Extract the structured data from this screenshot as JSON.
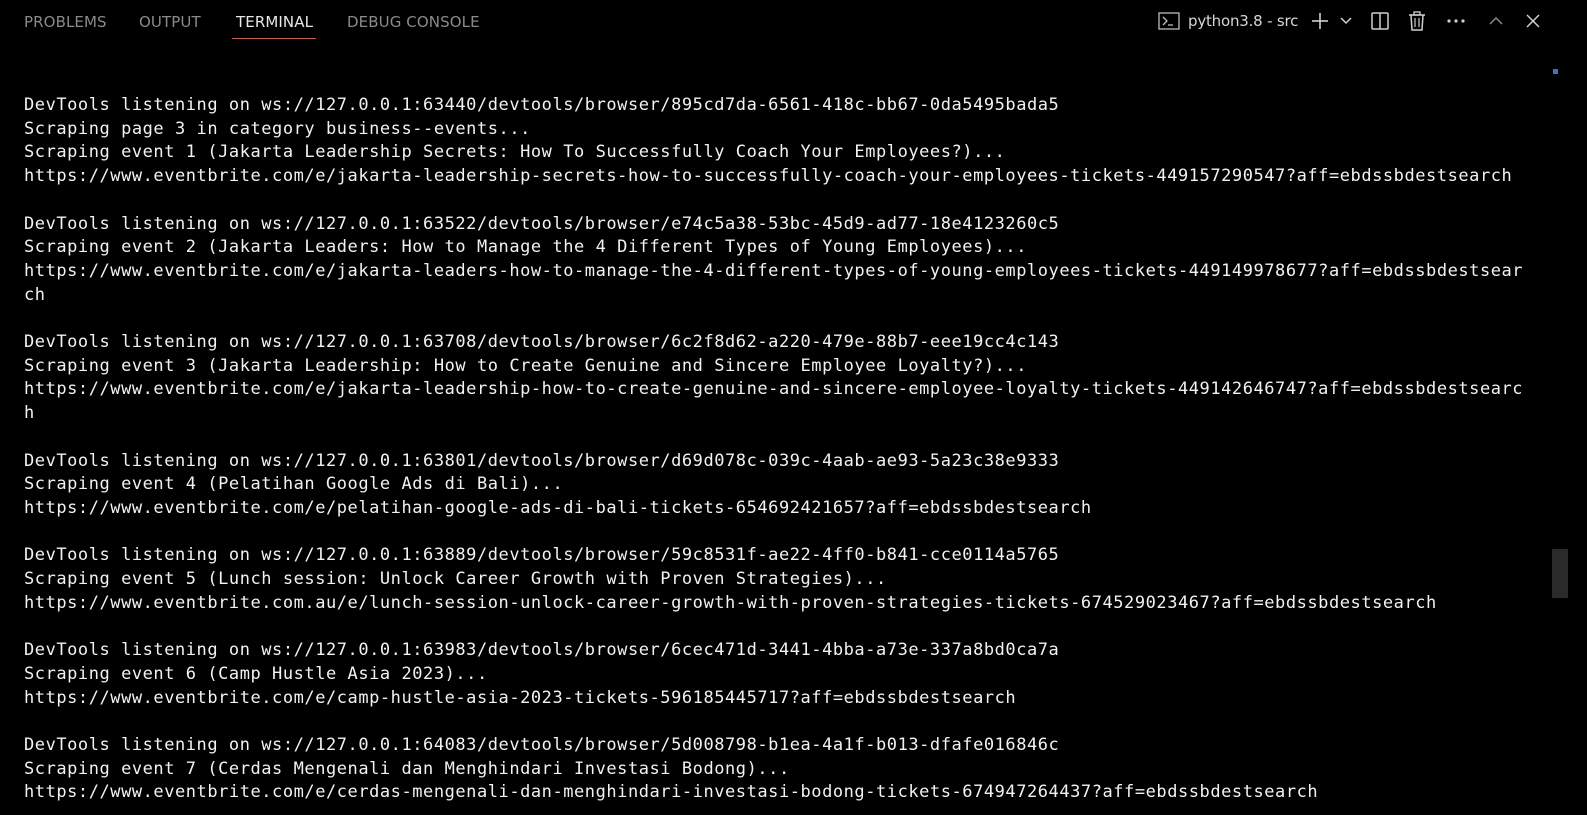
{
  "tabs": {
    "problems": "PROBLEMS",
    "output": "OUTPUT",
    "terminal": "TERMINAL",
    "debug_console": "DEBUG CONSOLE"
  },
  "active_tab": "TERMINAL",
  "terminal_instance": {
    "label": "python3.8 - src"
  },
  "toolbar_icons": [
    "terminal-icon",
    "plus-icon",
    "chevron-down-icon",
    "split-icon",
    "trash-icon",
    "more-icon",
    "chevron-up-icon",
    "close-icon"
  ],
  "colors": {
    "background": "#000000",
    "text": "#f2f2f2",
    "active_tab_underline": "#c75c4a",
    "scroll_marker": "#3a75c4"
  },
  "terminal_lines": [
    "DevTools listening on ws://127.0.0.1:63440/devtools/browser/895cd7da-6561-418c-bb67-0da5495bada5",
    "Scraping page 3 in category business--events...",
    "Scraping event 1 (Jakarta Leadership Secrets: How To Successfully Coach Your Employees?)...",
    "https://www.eventbrite.com/e/jakarta-leadership-secrets-how-to-successfully-coach-your-employees-tickets-449157290547?aff=ebdssbdestsearch",
    "",
    "DevTools listening on ws://127.0.0.1:63522/devtools/browser/e74c5a38-53bc-45d9-ad77-18e4123260c5",
    "Scraping event 2 (Jakarta Leaders: How to Manage the 4 Different Types of Young Employees)...",
    "https://www.eventbrite.com/e/jakarta-leaders-how-to-manage-the-4-different-types-of-young-employees-tickets-449149978677?aff=ebdssbdestsear",
    "ch",
    "",
    "DevTools listening on ws://127.0.0.1:63708/devtools/browser/6c2f8d62-a220-479e-88b7-eee19cc4c143",
    "Scraping event 3 (Jakarta Leadership: How to Create Genuine and Sincere Employee Loyalty?)...",
    "https://www.eventbrite.com/e/jakarta-leadership-how-to-create-genuine-and-sincere-employee-loyalty-tickets-449142646747?aff=ebdssbdestsearc",
    "h",
    "",
    "DevTools listening on ws://127.0.0.1:63801/devtools/browser/d69d078c-039c-4aab-ae93-5a23c38e9333",
    "Scraping event 4 (Pelatihan Google Ads di Bali)...",
    "https://www.eventbrite.com/e/pelatihan-google-ads-di-bali-tickets-654692421657?aff=ebdssbdestsearch",
    "",
    "DevTools listening on ws://127.0.0.1:63889/devtools/browser/59c8531f-ae22-4ff0-b841-cce0114a5765",
    "Scraping event 5 (Lunch session: Unlock Career Growth with Proven Strategies)...",
    "https://www.eventbrite.com.au/e/lunch-session-unlock-career-growth-with-proven-strategies-tickets-674529023467?aff=ebdssbdestsearch",
    "",
    "DevTools listening on ws://127.0.0.1:63983/devtools/browser/6cec471d-3441-4bba-a73e-337a8bd0ca7a",
    "Scraping event 6 (Camp Hustle Asia 2023)...",
    "https://www.eventbrite.com/e/camp-hustle-asia-2023-tickets-596185445717?aff=ebdssbdestsearch",
    "",
    "DevTools listening on ws://127.0.0.1:64083/devtools/browser/5d008798-b1ea-4a1f-b013-dfafe016846c",
    "Scraping event 7 (Cerdas Mengenali dan Menghindari Investasi Bodong)...",
    "https://www.eventbrite.com/e/cerdas-mengenali-dan-menghindari-investasi-bodong-tickets-674947264437?aff=ebdssbdestsearch"
  ]
}
